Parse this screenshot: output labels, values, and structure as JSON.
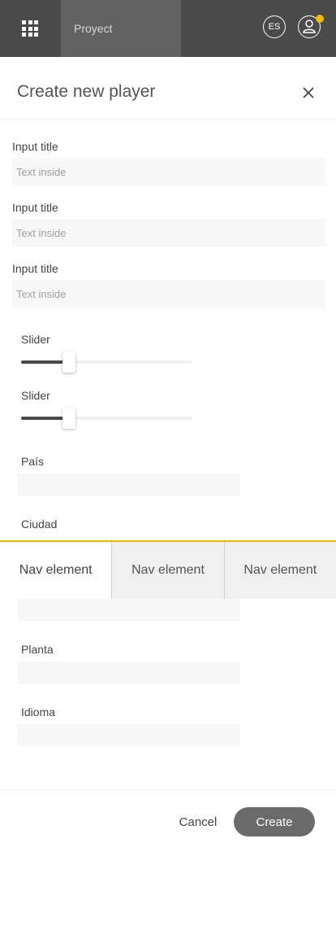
{
  "topbar": {
    "project_label": "Proyect",
    "language": "ES",
    "notification_color": "#f5b800"
  },
  "modal": {
    "title": "Create new player",
    "close_icon": "close-icon"
  },
  "inputs": [
    {
      "label": "Input title",
      "placeholder": "Text inside"
    },
    {
      "label": "Input title",
      "placeholder": "Text inside"
    },
    {
      "label": "Input title",
      "placeholder": "Text inside"
    }
  ],
  "sliders": [
    {
      "label": "Slider",
      "value_percent": 28
    },
    {
      "label": "Slider",
      "value_percent": 28
    }
  ],
  "selects": [
    {
      "label": "País",
      "value": ""
    },
    {
      "label": "Ciudad",
      "value": ""
    },
    {
      "label": "Planta",
      "value": ""
    },
    {
      "label": "Idioma",
      "value": ""
    }
  ],
  "nav": {
    "items": [
      "Nav element",
      "Nav element",
      "Nav element"
    ],
    "active_index": 0,
    "accent_color": "#f5b800"
  },
  "footer": {
    "cancel_label": "Cancel",
    "create_label": "Create"
  }
}
